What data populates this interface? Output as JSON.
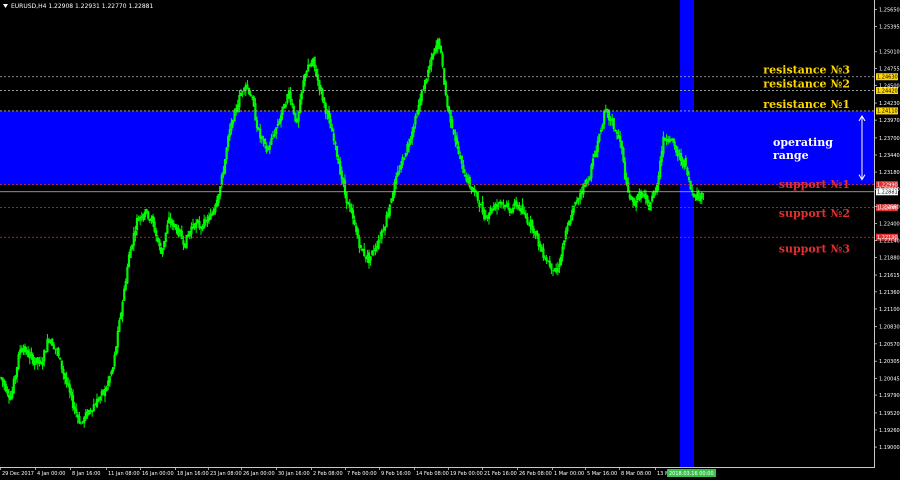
{
  "header": {
    "title": "EURUSD,H4 1.22908 1.22931 1.22770 1.22881"
  },
  "colors": {
    "candle": "#00ff00",
    "zone": "#0000ff",
    "resistance": "#ffd700",
    "support": "#e03030",
    "current": "#c0c0c0"
  },
  "icons": {
    "sort_marker": "triangle-down-icon"
  },
  "chart_data": {
    "type": "candlestick",
    "ylim": [
      1.18925,
      1.25675
    ],
    "y_ticks": [
      "1.25650",
      "1.25395",
      "1.25010",
      "1.24755",
      "1.24500",
      "1.24230",
      "1.23970",
      "1.23700",
      "1.23440",
      "1.23180",
      "1.22920",
      "1.22660",
      "1.22400",
      "1.22140",
      "1.21880",
      "1.21615",
      "1.21360",
      "1.21100",
      "1.20830",
      "1.20570",
      "1.20305",
      "1.20045",
      "1.19790",
      "1.19520",
      "1.19260",
      "1.19000"
    ],
    "x_ticks": [
      "29 Dec 2017",
      "4 Jan 00:00",
      "8 Jan 16:00",
      "11 Jan 08:00",
      "16 Jan 00:00",
      "18 Jan 16:00",
      "23 Jan 08:00",
      "26 Jan 00:00",
      "30 Jan 16:00",
      "2 Feb 08:00",
      "7 Feb 00:00",
      "9 Feb 16:00",
      "14 Feb 08:00",
      "19 Feb 00:00",
      "21 Feb 16:00",
      "26 Feb 08:00",
      "1 Mar 00:00",
      "5 Mar 16:00",
      "8 Mar 08:00",
      "13 Mar 00:00"
    ],
    "highlight_tick": "2018.03.16 00:00",
    "close_path": [
      [
        0,
        1.2005
      ],
      [
        10,
        1.1975
      ],
      [
        20,
        1.2055
      ],
      [
        30,
        1.2035
      ],
      [
        40,
        1.2025
      ],
      [
        48,
        1.2068
      ],
      [
        56,
        1.2045
      ],
      [
        64,
        1.2005
      ],
      [
        72,
        1.1965
      ],
      [
        80,
        1.1935
      ],
      [
        88,
        1.1955
      ],
      [
        96,
        1.197
      ],
      [
        104,
        1.1985
      ],
      [
        112,
        1.202
      ],
      [
        120,
        1.2105
      ],
      [
        128,
        1.219
      ],
      [
        136,
        1.2245
      ],
      [
        144,
        1.226
      ],
      [
        152,
        1.224
      ],
      [
        160,
        1.2195
      ],
      [
        168,
        1.2245
      ],
      [
        176,
        1.223
      ],
      [
        184,
        1.221
      ],
      [
        192,
        1.224
      ],
      [
        200,
        1.2235
      ],
      [
        210,
        1.225
      ],
      [
        220,
        1.23
      ],
      [
        228,
        1.2375
      ],
      [
        236,
        1.242
      ],
      [
        244,
        1.2455
      ],
      [
        250,
        1.2435
      ],
      [
        258,
        1.2375
      ],
      [
        266,
        1.235
      ],
      [
        274,
        1.238
      ],
      [
        280,
        1.2405
      ],
      [
        288,
        1.244
      ],
      [
        296,
        1.239
      ],
      [
        304,
        1.247
      ],
      [
        312,
        1.2485
      ],
      [
        320,
        1.244
      ],
      [
        328,
        1.2395
      ],
      [
        336,
        1.2345
      ],
      [
        344,
        1.2285
      ],
      [
        352,
        1.2245
      ],
      [
        360,
        1.22
      ],
      [
        368,
        1.2185
      ],
      [
        376,
        1.221
      ],
      [
        384,
        1.224
      ],
      [
        392,
        1.229
      ],
      [
        400,
        1.233
      ],
      [
        408,
        1.2365
      ],
      [
        416,
        1.241
      ],
      [
        424,
        1.2455
      ],
      [
        432,
        1.2495
      ],
      [
        438,
        1.252
      ],
      [
        446,
        1.242
      ],
      [
        452,
        1.2385
      ],
      [
        460,
        1.233
      ],
      [
        468,
        1.23
      ],
      [
        476,
        1.228
      ],
      [
        484,
        1.225
      ],
      [
        492,
        1.2265
      ],
      [
        500,
        1.2275
      ],
      [
        508,
        1.226
      ],
      [
        516,
        1.227
      ],
      [
        524,
        1.225
      ],
      [
        532,
        1.2235
      ],
      [
        540,
        1.22
      ],
      [
        548,
        1.218
      ],
      [
        556,
        1.2165
      ],
      [
        564,
        1.222
      ],
      [
        572,
        1.226
      ],
      [
        580,
        1.229
      ],
      [
        588,
        1.231
      ],
      [
        596,
        1.236
      ],
      [
        604,
        1.241
      ],
      [
        612,
        1.239
      ],
      [
        620,
        1.236
      ],
      [
        626,
        1.229
      ],
      [
        632,
        1.227
      ],
      [
        640,
        1.2285
      ],
      [
        648,
        1.2265
      ],
      [
        656,
        1.23
      ],
      [
        662,
        1.2365
      ],
      [
        668,
        1.2375
      ],
      [
        676,
        1.2345
      ],
      [
        684,
        1.233
      ],
      [
        690,
        1.229
      ],
      [
        698,
        1.228
      ],
      [
        704,
        1.2288
      ]
    ],
    "levels": [
      {
        "label": "resistance №3",
        "price": "1.24630",
        "value": 1.2463,
        "kind": "resistance"
      },
      {
        "label": "resistance №2",
        "price": "1.24420",
        "value": 1.2442,
        "kind": "resistance"
      },
      {
        "label": "resistance №1",
        "price": "1.24110",
        "value": 1.2411,
        "kind": "resistance"
      },
      {
        "label": "support №1",
        "price": "1.22990",
        "value": 1.2299,
        "kind": "support"
      },
      {
        "label": "support №2",
        "price": "1.22640",
        "value": 1.2264,
        "kind": "support"
      },
      {
        "label": "support №3",
        "price": "1.22190",
        "value": 1.2219,
        "kind": "support"
      }
    ],
    "current_price": {
      "label": "1.22881",
      "value": 1.22881
    },
    "operating_range": {
      "label": "operating range",
      "top": 1.2411,
      "bottom": 1.2299
    }
  }
}
